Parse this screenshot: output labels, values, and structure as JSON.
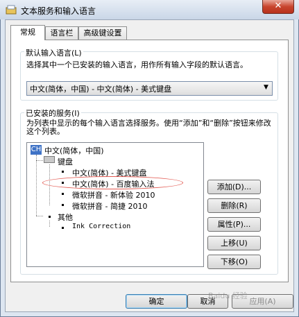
{
  "window": {
    "title": "文本服务和输入语言",
    "close_glyph": "✕"
  },
  "tabs": [
    {
      "label": "常规",
      "active": true
    },
    {
      "label": "语言栏",
      "active": false
    },
    {
      "label": "高级键设置",
      "active": false
    }
  ],
  "default_language": {
    "title": "默认输入语言(L)",
    "description": "选择其中一个已安装的输入语言，用作所有输入字段的默认语言。",
    "selected": "中文(简体，中国) - 中文(简体) - 美式键盘"
  },
  "services": {
    "title": "已安装的服务(I)",
    "description": "为列表中显示的每个输入语言选择服务。使用“添加”和“删除”按钮来修改这个列表。",
    "tree": {
      "language_badge": "CH",
      "language": "中文(简体，中国)",
      "keyboard_group": "键盘",
      "keyboards": [
        "中文(简体) - 美式键盘",
        "中文(简体) - 百度输入法",
        "微软拼音 - 新体验 2010",
        "微软拼音 - 简捷 2010"
      ],
      "other_group": "其他",
      "other_items": [
        "Ink Correction"
      ]
    },
    "buttons": {
      "add": "添加(D)...",
      "remove": "删除(R)",
      "properties": "属性(P)...",
      "move_up": "上移(U)",
      "move_down": "下移(O)"
    }
  },
  "footer": {
    "ok": "确定",
    "cancel": "取消",
    "apply": "应用(A)"
  },
  "watermark": "Baidu 经验",
  "colors": {
    "highlight_ellipse": "#e35a52",
    "ch_badge": "#3f73c6"
  }
}
